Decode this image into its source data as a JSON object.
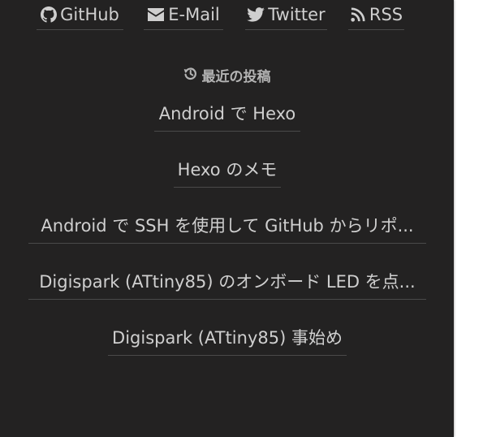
{
  "social": {
    "github": {
      "label": "GitHub",
      "icon": "github-icon"
    },
    "email": {
      "label": "E-Mail",
      "icon": "envelope-icon"
    },
    "twitter": {
      "label": "Twitter",
      "icon": "twitter-icon"
    },
    "rss": {
      "label": "RSS",
      "icon": "rss-icon"
    }
  },
  "recent": {
    "title": "最近の投稿",
    "icon": "history-icon",
    "posts": [
      {
        "title": "Android で Hexo"
      },
      {
        "title": "Hexo のメモ"
      },
      {
        "title": "Android で SSH を使用して GitHub からリポ..."
      },
      {
        "title": "Digispark (ATtiny85) のオンボード LED を点..."
      },
      {
        "title": "Digispark (ATtiny85) 事始め"
      }
    ]
  },
  "colors": {
    "background": "#232222",
    "text": "#cfcfcf",
    "divider": "#4a4a4a"
  }
}
